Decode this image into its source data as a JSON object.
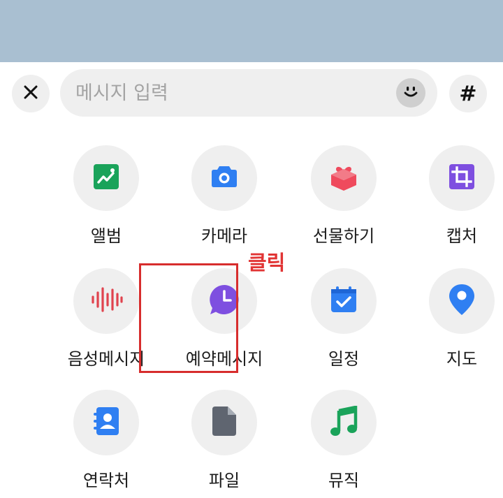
{
  "input_bar": {
    "placeholder": "메시지 입력",
    "close_icon": "close-icon",
    "emoji_icon": "smiley-icon",
    "hash_label": "#"
  },
  "features": [
    {
      "label": "앨범",
      "icon": "album-icon",
      "color": "#1aa35a"
    },
    {
      "label": "카메라",
      "icon": "camera-icon",
      "color": "#2f7ff2"
    },
    {
      "label": "선물하기",
      "icon": "gift-icon",
      "color": "#ef4a5d"
    },
    {
      "label": "캡처",
      "icon": "crop-icon",
      "color": "#7e4fe0"
    },
    {
      "label": "음성메시지",
      "icon": "voice-wave-icon",
      "color": "#e0434e"
    },
    {
      "label": "예약메시지",
      "icon": "scheduled-message-icon",
      "color": "#7e4fe0"
    },
    {
      "label": "일정",
      "icon": "calendar-check-icon",
      "color": "#2f7ff2"
    },
    {
      "label": "지도",
      "icon": "map-pin-icon",
      "color": "#2f7ff2"
    },
    {
      "label": "연락처",
      "icon": "contacts-icon",
      "color": "#2f7ff2"
    },
    {
      "label": "파일",
      "icon": "file-icon",
      "color": "#5f6570"
    },
    {
      "label": "뮤직",
      "icon": "music-note-icon",
      "color": "#1aa35a"
    }
  ],
  "annotation": {
    "text": "클릭",
    "color": "#e13434",
    "target": "예약메시지"
  }
}
